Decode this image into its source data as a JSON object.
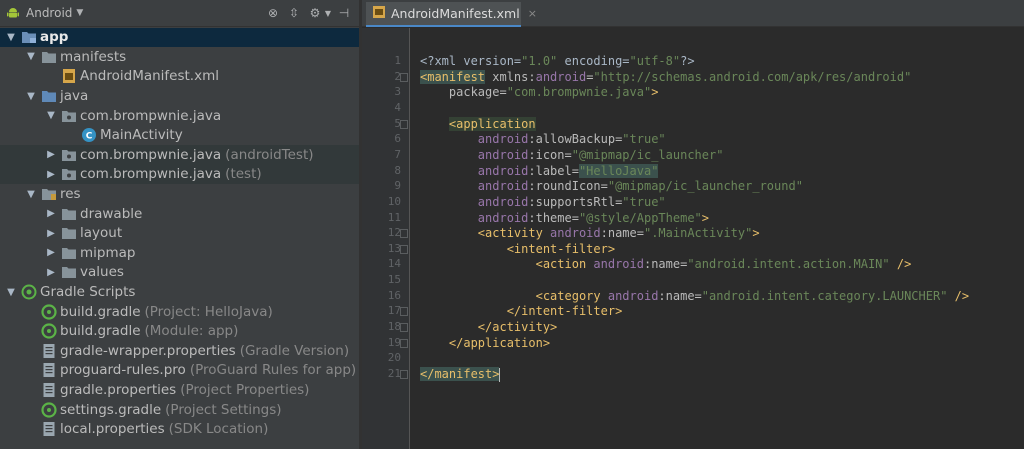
{
  "toolbar": {
    "view_mode": "Android",
    "buttons": [
      {
        "icon": "target-icon",
        "glyph": "⊗"
      },
      {
        "icon": "collapse-all-icon",
        "glyph": "⇳"
      },
      {
        "icon": "gear-icon",
        "glyph": "⚙▾"
      },
      {
        "icon": "hide-panel-icon",
        "glyph": "⊣"
      }
    ]
  },
  "tree": [
    {
      "label": "app",
      "suffix": "",
      "expanded": true,
      "icon": "module-folder-icon",
      "level": 0,
      "selected": true,
      "bold": true
    },
    {
      "label": "manifests",
      "suffix": "",
      "expanded": true,
      "icon": "folder-icon",
      "level": 1
    },
    {
      "label": "AndroidManifest.xml",
      "suffix": "",
      "expanded": null,
      "icon": "xml-file-icon",
      "level": 2
    },
    {
      "label": "java",
      "suffix": "",
      "expanded": true,
      "icon": "source-folder-icon",
      "level": 1
    },
    {
      "label": "com.brompwnie.java",
      "suffix": "",
      "expanded": true,
      "icon": "package-icon",
      "level": 2
    },
    {
      "label": "MainActivity",
      "suffix": "",
      "expanded": null,
      "icon": "class-icon",
      "level": 3
    },
    {
      "label": "com.brompwnie.java",
      "suffix": "(androidTest)",
      "expanded": false,
      "icon": "package-icon",
      "level": 2,
      "highlight": true
    },
    {
      "label": "com.brompwnie.java",
      "suffix": "(test)",
      "expanded": false,
      "icon": "package-icon",
      "level": 2,
      "highlight": true
    },
    {
      "label": "res",
      "suffix": "",
      "expanded": true,
      "icon": "resource-folder-icon",
      "level": 1
    },
    {
      "label": "drawable",
      "suffix": "",
      "expanded": false,
      "icon": "folder-icon",
      "level": 2
    },
    {
      "label": "layout",
      "suffix": "",
      "expanded": false,
      "icon": "folder-icon",
      "level": 2
    },
    {
      "label": "mipmap",
      "suffix": "",
      "expanded": false,
      "icon": "folder-icon",
      "level": 2
    },
    {
      "label": "values",
      "suffix": "",
      "expanded": false,
      "icon": "folder-icon",
      "level": 2
    },
    {
      "label": "Gradle Scripts",
      "suffix": "",
      "expanded": true,
      "icon": "gradle-icon",
      "level": 0
    },
    {
      "label": "build.gradle",
      "suffix": "(Project: HelloJava)",
      "expanded": null,
      "icon": "gradle-file-icon",
      "level": 1
    },
    {
      "label": "build.gradle",
      "suffix": "(Module: app)",
      "expanded": null,
      "icon": "gradle-file-icon",
      "level": 1
    },
    {
      "label": "gradle-wrapper.properties",
      "suffix": "(Gradle Version)",
      "expanded": null,
      "icon": "properties-file-icon",
      "level": 1
    },
    {
      "label": "proguard-rules.pro",
      "suffix": "(ProGuard Rules for app)",
      "expanded": null,
      "icon": "properties-file-icon",
      "level": 1
    },
    {
      "label": "gradle.properties",
      "suffix": "(Project Properties)",
      "expanded": null,
      "icon": "properties-file-icon",
      "level": 1
    },
    {
      "label": "settings.gradle",
      "suffix": "(Project Settings)",
      "expanded": null,
      "icon": "gradle-file-icon",
      "level": 1
    },
    {
      "label": "local.properties",
      "suffix": "(SDK Location)",
      "expanded": null,
      "icon": "properties-file-icon",
      "level": 1
    }
  ],
  "tabs": [
    {
      "label": "AndroidManifest.xml",
      "active": true,
      "close_glyph": "×"
    }
  ],
  "editor": {
    "line_numbers": [
      "1",
      "2",
      "3",
      "4",
      "5",
      "6",
      "7",
      "8",
      "9",
      "10",
      "11",
      "12",
      "13",
      "14",
      "15",
      "16",
      "17",
      "18",
      "19",
      "20",
      "21"
    ],
    "lines": [
      [
        {
          "t": "<?xml version=",
          "c": "t-prolog"
        },
        {
          "t": "\"1.0\"",
          "c": "t-val"
        },
        {
          "t": " encoding=",
          "c": "t-prolog"
        },
        {
          "t": "\"utf-8\"",
          "c": "t-val"
        },
        {
          "t": "?>",
          "c": "t-prolog"
        }
      ],
      [
        {
          "t": "<manifest",
          "c": "t-tag t-hl"
        },
        {
          "t": " xmlns:",
          "c": "t-attr"
        },
        {
          "t": "android",
          "c": "t-ns"
        },
        {
          "t": "=",
          "c": "t-attr"
        },
        {
          "t": "\"http://schemas.android.com/apk/res/android\"",
          "c": "t-val"
        }
      ],
      [
        {
          "t": "    package=",
          "c": "t-attr"
        },
        {
          "t": "\"com.brompwnie.java\"",
          "c": "t-val"
        },
        {
          "t": ">",
          "c": "t-tag"
        }
      ],
      [],
      [
        {
          "t": "    ",
          "c": ""
        },
        {
          "t": "<application",
          "c": "t-tag t-hl2"
        }
      ],
      [
        {
          "t": "        ",
          "c": ""
        },
        {
          "t": "android",
          "c": "t-ns"
        },
        {
          "t": ":allowBackup=",
          "c": "t-attr"
        },
        {
          "t": "\"true\"",
          "c": "t-val"
        }
      ],
      [
        {
          "t": "        ",
          "c": ""
        },
        {
          "t": "android",
          "c": "t-ns"
        },
        {
          "t": ":icon=",
          "c": "t-attr"
        },
        {
          "t": "\"@mipmap/ic_launcher\"",
          "c": "t-val"
        }
      ],
      [
        {
          "t": "        ",
          "c": ""
        },
        {
          "t": "android",
          "c": "t-ns"
        },
        {
          "t": ":label=",
          "c": "t-attr"
        },
        {
          "t": "\"HelloJava\"",
          "c": "t-val t-hl"
        }
      ],
      [
        {
          "t": "        ",
          "c": ""
        },
        {
          "t": "android",
          "c": "t-ns"
        },
        {
          "t": ":roundIcon=",
          "c": "t-attr"
        },
        {
          "t": "\"@mipmap/ic_launcher_round\"",
          "c": "t-val"
        }
      ],
      [
        {
          "t": "        ",
          "c": ""
        },
        {
          "t": "android",
          "c": "t-ns"
        },
        {
          "t": ":supportsRtl=",
          "c": "t-attr"
        },
        {
          "t": "\"true\"",
          "c": "t-val"
        }
      ],
      [
        {
          "t": "        ",
          "c": ""
        },
        {
          "t": "android",
          "c": "t-ns"
        },
        {
          "t": ":theme=",
          "c": "t-attr"
        },
        {
          "t": "\"@style/AppTheme\"",
          "c": "t-val"
        },
        {
          "t": ">",
          "c": "t-tag"
        }
      ],
      [
        {
          "t": "        ",
          "c": ""
        },
        {
          "t": "<activity ",
          "c": "t-tag"
        },
        {
          "t": "android",
          "c": "t-ns"
        },
        {
          "t": ":name=",
          "c": "t-attr"
        },
        {
          "t": "\".MainActivity\"",
          "c": "t-val"
        },
        {
          "t": ">",
          "c": "t-tag"
        }
      ],
      [
        {
          "t": "            ",
          "c": ""
        },
        {
          "t": "<intent-filter>",
          "c": "t-tag"
        }
      ],
      [
        {
          "t": "                ",
          "c": ""
        },
        {
          "t": "<action ",
          "c": "t-tag"
        },
        {
          "t": "android",
          "c": "t-ns"
        },
        {
          "t": ":name=",
          "c": "t-attr"
        },
        {
          "t": "\"android.intent.action.MAIN\"",
          "c": "t-val"
        },
        {
          "t": " />",
          "c": "t-tag"
        }
      ],
      [],
      [
        {
          "t": "                ",
          "c": ""
        },
        {
          "t": "<category ",
          "c": "t-tag"
        },
        {
          "t": "android",
          "c": "t-ns"
        },
        {
          "t": ":name=",
          "c": "t-attr"
        },
        {
          "t": "\"android.intent.category.LAUNCHER\"",
          "c": "t-val"
        },
        {
          "t": " />",
          "c": "t-tag"
        }
      ],
      [
        {
          "t": "            ",
          "c": ""
        },
        {
          "t": "</intent-filter>",
          "c": "t-tag"
        }
      ],
      [
        {
          "t": "        ",
          "c": ""
        },
        {
          "t": "</activity>",
          "c": "t-tag"
        }
      ],
      [
        {
          "t": "    ",
          "c": ""
        },
        {
          "t": "</application>",
          "c": "t-tag"
        }
      ],
      [],
      [
        {
          "t": "</manifest>",
          "c": "t-tag t-hl"
        }
      ]
    ]
  }
}
